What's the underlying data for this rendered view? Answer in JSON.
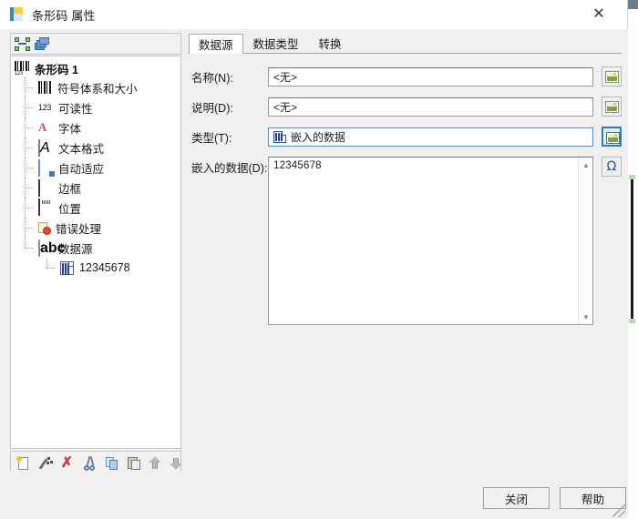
{
  "window": {
    "title": "条形码 属性",
    "icon": "barcode-properties-icon",
    "close_label": "✕"
  },
  "tree_panel": {
    "top_toolbar": [
      {
        "name": "select-nodes-icon",
        "label": ""
      },
      {
        "name": "layers-icon",
        "label": ""
      }
    ],
    "root": {
      "label": "条形码 1",
      "icon": "barcode-icon"
    },
    "items": [
      {
        "label": "符号体系和大小",
        "icon": "barcode-symbology-icon"
      },
      {
        "label": "可读性",
        "icon": "human-readable-123-icon"
      },
      {
        "label": "字体",
        "icon": "font-icon"
      },
      {
        "label": "文本格式",
        "icon": "text-format-icon"
      },
      {
        "label": "自动适应",
        "icon": "auto-fit-icon"
      },
      {
        "label": "边框",
        "icon": "border-icon"
      },
      {
        "label": "位置",
        "icon": "position-icon"
      },
      {
        "label": "错误处理",
        "icon": "error-handling-icon"
      },
      {
        "label": "数据源",
        "icon": "abc-data-source-icon"
      }
    ],
    "child": {
      "label": "12345678",
      "icon": "embedded-data-icon"
    },
    "bottom_toolbar": [
      {
        "name": "new-icon",
        "label": ""
      },
      {
        "name": "wizard-icon",
        "label": ""
      },
      {
        "name": "delete-icon",
        "label": "✗"
      },
      {
        "name": "cut-icon",
        "label": ""
      },
      {
        "name": "copy-icon",
        "label": ""
      },
      {
        "name": "paste-icon",
        "label": ""
      },
      {
        "name": "move-up-icon",
        "label": ""
      },
      {
        "name": "move-down-icon",
        "label": ""
      }
    ]
  },
  "content": {
    "tabs": [
      {
        "label": "数据源",
        "active": true
      },
      {
        "label": "数据类型",
        "active": false
      },
      {
        "label": "转换",
        "active": false
      }
    ],
    "fields": {
      "name": {
        "label": "名称(N):",
        "value": "<无>"
      },
      "description": {
        "label": "说明(D):",
        "value": "<无>"
      },
      "type": {
        "label": "类型(T):",
        "value": "嵌入的数据",
        "icon": "embedded-data-icon"
      }
    },
    "embedded_data": {
      "label": "嵌入的数据(D):",
      "value": "12345678",
      "insert_symbol_label": "Ω"
    }
  },
  "footer": {
    "close_label": "关闭",
    "help_label": "帮助"
  },
  "colors": {
    "dialog_bg": "#f0f0f0",
    "accent_blue": "#2b7cd3",
    "delete_red": "#d13b2e",
    "omega_blue": "#2b4f9e"
  }
}
